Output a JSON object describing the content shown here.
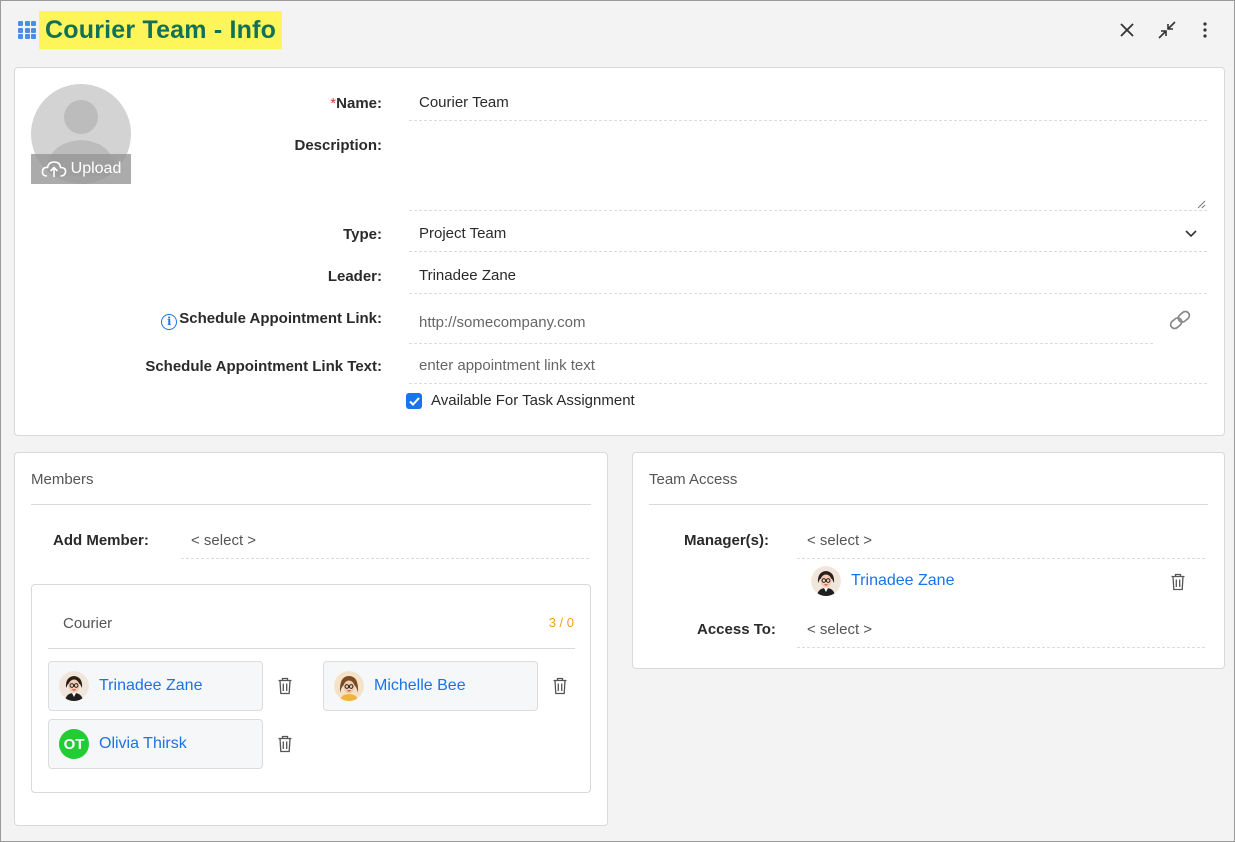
{
  "header": {
    "title": "Courier Team - Info",
    "icons": [
      "grid-icon",
      "close-icon",
      "collapse-icon",
      "more-vertical-icon"
    ]
  },
  "avatar": {
    "upload_label": "Upload"
  },
  "form": {
    "name_required_mark": "*",
    "name_label": "Name:",
    "name_value": "Courier Team",
    "description_label": "Description:",
    "description_value": "",
    "type_label": "Type:",
    "type_value": "Project Team",
    "leader_label": "Leader:",
    "leader_value": "Trinadee Zane",
    "schedule_link_label": "Schedule Appointment Link:",
    "schedule_link_placeholder": "http://somecompany.com",
    "schedule_link_text_label": "Schedule Appointment Link Text:",
    "schedule_link_text_placeholder": "enter appointment link text",
    "available_label": "Available For Task Assignment",
    "available_checked": true
  },
  "members": {
    "title": "Members",
    "add_member_label": "Add Member:",
    "add_member_value": "< select >",
    "group": {
      "name": "Courier",
      "count": "3 / 0",
      "items": [
        {
          "name": "Trinadee Zane",
          "avatar": "photo-female-glasses"
        },
        {
          "name": "Michelle Bee",
          "avatar": "photo-female-blonde"
        },
        {
          "name": "Olivia Thirsk",
          "avatar": "initials",
          "initials": "OT",
          "color": "#22cc33"
        }
      ]
    }
  },
  "team_access": {
    "title": "Team Access",
    "managers_label": "Manager(s):",
    "managers_select": "< select >",
    "managers": [
      {
        "name": "Trinadee Zane"
      }
    ],
    "access_to_label": "Access To:",
    "access_to_select": "< select >"
  },
  "colors": {
    "title_highlight": "#fdf55a",
    "title_text": "#127057",
    "link_blue": "#1a73e8",
    "required_red": "#d9363e",
    "count_orange": "#f0a020"
  }
}
